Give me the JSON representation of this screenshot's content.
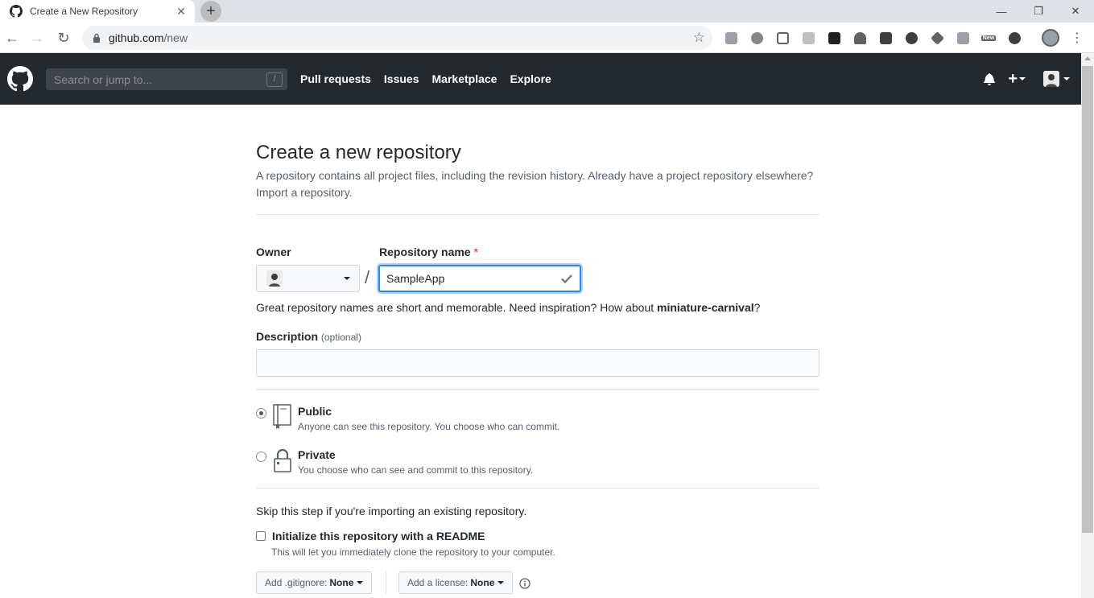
{
  "browser": {
    "tab_title": "Create a New Repository",
    "url_host": "github.com",
    "url_path": "/new",
    "extension_badge": "New"
  },
  "header": {
    "search_placeholder": "Search or jump to...",
    "search_shortcut": "/",
    "nav": [
      "Pull requests",
      "Issues",
      "Marketplace",
      "Explore"
    ]
  },
  "page": {
    "title": "Create a new repository",
    "subtitle": "A repository contains all project files, including the revision history. Already have a project repository elsewhere?",
    "import_link": "Import a repository.",
    "owner_label": "Owner",
    "repo_label": "Repository name",
    "required_mark": "*",
    "separator": "/",
    "repo_value": "SampleApp",
    "hint_prefix": "Great repository names are short and memorable. Need inspiration? How about ",
    "hint_suggestion": "miniature-carnival",
    "hint_suffix": "?",
    "description_label": "Description",
    "description_optional": "(optional)",
    "description_value": "",
    "visibility": [
      {
        "title": "Public",
        "desc": "Anyone can see this repository. You choose who can commit.",
        "selected": true
      },
      {
        "title": "Private",
        "desc": "You choose who can see and commit to this repository.",
        "selected": false
      }
    ],
    "skip_text": "Skip this step if you're importing an existing repository.",
    "init_label": "Initialize this repository with a README",
    "init_note": "This will let you immediately clone the repository to your computer.",
    "gitignore_label": "Add .gitignore:",
    "gitignore_value": "None",
    "license_label": "Add a license:",
    "license_value": "None"
  },
  "colors": {
    "header_bg": "#24292e",
    "focus_blue": "#2188ff",
    "required_red": "#cb2431"
  }
}
